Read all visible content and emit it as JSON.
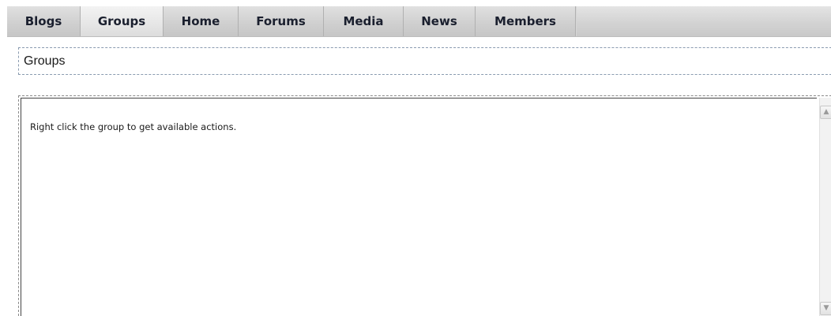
{
  "nav": {
    "tabs": [
      {
        "label": "Blogs",
        "active": false
      },
      {
        "label": "Groups",
        "active": true
      },
      {
        "label": "Home",
        "active": false
      },
      {
        "label": "Forums",
        "active": false
      },
      {
        "label": "Media",
        "active": false
      },
      {
        "label": "News",
        "active": false
      },
      {
        "label": "Members",
        "active": false
      }
    ]
  },
  "header": {
    "title": "Groups"
  },
  "content": {
    "hint": "Right click the group to get available actions."
  },
  "scrollbar": {
    "up_icon": "scroll-up-arrow-icon",
    "down_icon": "scroll-down-arrow-icon",
    "up_glyph": "▲",
    "down_glyph": "▼"
  },
  "colors": {
    "tab_text": "#1a1f2e",
    "tab_bg": "#cfcfcf",
    "panel_border": "#8a8a8a"
  }
}
